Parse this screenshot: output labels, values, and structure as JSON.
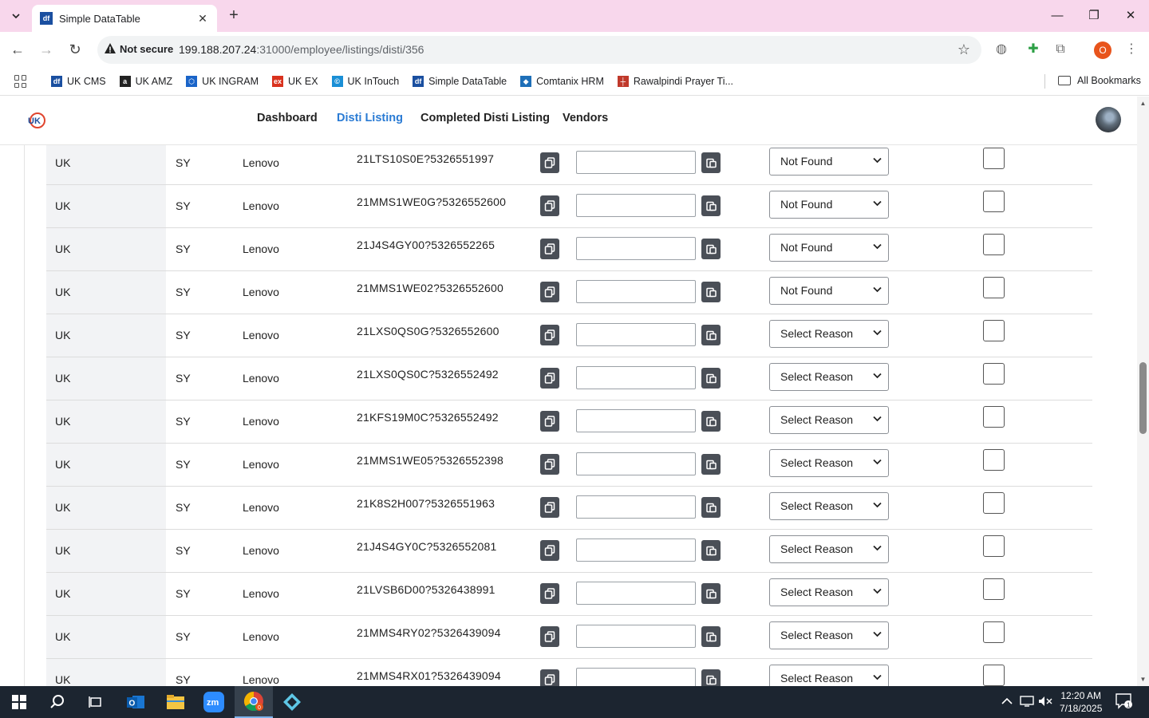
{
  "browser": {
    "tab_title": "Simple DataTable",
    "tab_favicon": "df",
    "not_secure_label": "Not secure",
    "url_host": "199.188.207.24",
    "url_rest": ":31000/employee/listings/disti/356",
    "profile_initial": "O"
  },
  "bookmarks": {
    "items": [
      {
        "label": "UK CMS",
        "icon": "df-icon",
        "color": "#1a4fa0"
      },
      {
        "label": "UK AMZ",
        "icon": "amazon-icon",
        "color": "#222222"
      },
      {
        "label": "UK INGRAM",
        "icon": "ingram-icon",
        "color": "#1a64c8"
      },
      {
        "label": "UK EX",
        "icon": "ex-icon",
        "color": "#d9321e"
      },
      {
        "label": "UK InTouch",
        "icon": "intouch-icon",
        "color": "#1a8fd6"
      },
      {
        "label": "Simple DataTable",
        "icon": "df-icon",
        "color": "#1a4fa0"
      },
      {
        "label": "Comtanix HRM",
        "icon": "comtanix-icon",
        "color": "#1e6fb8"
      },
      {
        "label": "Rawalpindi Prayer Ti...",
        "icon": "prayer-icon",
        "color": "#c0392b"
      }
    ],
    "all_bookmarks": "All Bookmarks"
  },
  "nav": {
    "links": [
      "Dashboard",
      "Disti Listing",
      "Completed Disti Listing",
      "Vendors"
    ],
    "active": "Disti Listing"
  },
  "table": {
    "rows": [
      {
        "country": "UK",
        "code": "SY",
        "brand": "Lenovo",
        "sku": "21LTS10S0E?5326551997",
        "reason": "Not Found"
      },
      {
        "country": "UK",
        "code": "SY",
        "brand": "Lenovo",
        "sku": "21MMS1WE0G?5326552600",
        "reason": "Not Found"
      },
      {
        "country": "UK",
        "code": "SY",
        "brand": "Lenovo",
        "sku": "21J4S4GY00?5326552265",
        "reason": "Not Found"
      },
      {
        "country": "UK",
        "code": "SY",
        "brand": "Lenovo",
        "sku": "21MMS1WE02?5326552600",
        "reason": "Not Found"
      },
      {
        "country": "UK",
        "code": "SY",
        "brand": "Lenovo",
        "sku": "21LXS0QS0G?5326552600",
        "reason": "Select Reason"
      },
      {
        "country": "UK",
        "code": "SY",
        "brand": "Lenovo",
        "sku": "21LXS0QS0C?5326552492",
        "reason": "Select Reason"
      },
      {
        "country": "UK",
        "code": "SY",
        "brand": "Lenovo",
        "sku": "21KFS19M0C?5326552492",
        "reason": "Select Reason"
      },
      {
        "country": "UK",
        "code": "SY",
        "brand": "Lenovo",
        "sku": "21MMS1WE05?5326552398",
        "reason": "Select Reason"
      },
      {
        "country": "UK",
        "code": "SY",
        "brand": "Lenovo",
        "sku": "21K8S2H007?5326551963",
        "reason": "Select Reason"
      },
      {
        "country": "UK",
        "code": "SY",
        "brand": "Lenovo",
        "sku": "21J4S4GY0C?5326552081",
        "reason": "Select Reason"
      },
      {
        "country": "UK",
        "code": "SY",
        "brand": "Lenovo",
        "sku": "21LVSB6D00?5326438991",
        "reason": "Select Reason"
      },
      {
        "country": "UK",
        "code": "SY",
        "brand": "Lenovo",
        "sku": "21MMS4RY02?5326439094",
        "reason": "Select Reason"
      },
      {
        "country": "UK",
        "code": "SY",
        "brand": "Lenovo",
        "sku": "21MMS4RX01?5326439094",
        "reason": "Select Reason"
      }
    ]
  },
  "taskbar": {
    "time": "12:20 AM",
    "date": "7/18/2025",
    "notification_count": "1",
    "chrome_badge": "0"
  },
  "colors": {
    "tabstrip_bg": "#f8d7ec",
    "active_link": "#2a7bd4",
    "copy_button": "#4a4f57",
    "taskbar_bg": "#1c2530"
  }
}
